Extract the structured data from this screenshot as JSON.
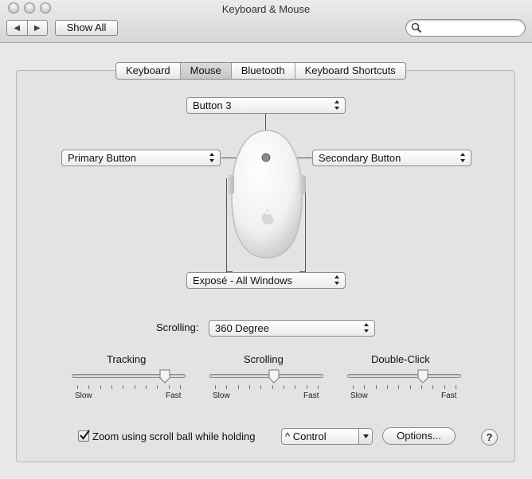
{
  "window": {
    "title": "Keyboard & Mouse"
  },
  "toolbar": {
    "back_label": "◀",
    "forward_label": "▶",
    "show_all_label": "Show All",
    "search_placeholder": ""
  },
  "tabs": [
    {
      "label": "Keyboard",
      "active": false
    },
    {
      "label": "Mouse",
      "active": true
    },
    {
      "label": "Bluetooth",
      "active": false
    },
    {
      "label": "Keyboard Shortcuts",
      "active": false
    }
  ],
  "mouse_buttons": {
    "top": "Button 3",
    "left": "Primary Button",
    "right": "Secondary Button",
    "bottom": "Exposé - All Windows"
  },
  "scrolling_mode": {
    "label": "Scrolling:",
    "value": "360 Degree"
  },
  "sliders": {
    "tracking": {
      "title": "Tracking",
      "min_label": "Slow",
      "max_label": "Fast",
      "level": 0.85
    },
    "scrolling": {
      "title": "Scrolling",
      "min_label": "Slow",
      "max_label": "Fast",
      "level": 0.57
    },
    "double_click": {
      "title": "Double-Click",
      "min_label": "Slow",
      "max_label": "Fast",
      "level": 0.68
    }
  },
  "zoom": {
    "label": "Zoom using scroll ball while holding",
    "checked": true,
    "modifier": "^ Control",
    "options_label": "Options...",
    "help_label": "?"
  },
  "colors": {
    "window_bg": "#e8e8e8",
    "panel_bg": "#e3e3e3",
    "border": "#8a8a8a"
  }
}
